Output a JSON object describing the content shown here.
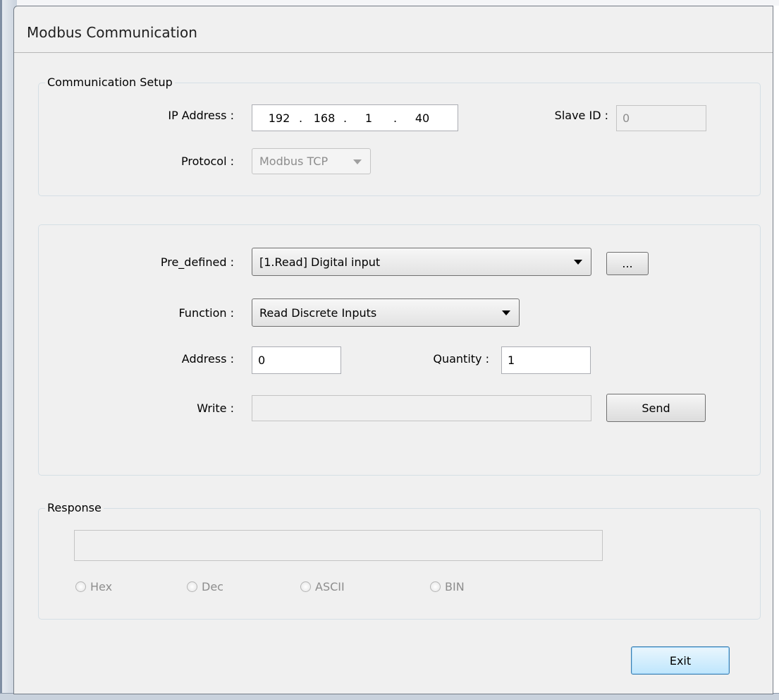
{
  "window": {
    "title": "Modbus Communication"
  },
  "setup": {
    "group_label": "Communication Setup",
    "ip_label": "IP Address :",
    "ip": {
      "o1": "192",
      "o2": "168",
      "o3": "1",
      "o4": "40"
    },
    "ip_dot": ".",
    "slave_label": "Slave ID :",
    "slave_value": "0",
    "protocol_label": "Protocol :",
    "protocol_value": "Modbus TCP"
  },
  "command": {
    "predefined_label": "Pre_defined :",
    "predefined_value": "[1.Read] Digital input",
    "browse_button": "...",
    "function_label": "Function :",
    "function_value": "Read Discrete Inputs",
    "address_label": "Address :",
    "address_value": "0",
    "quantity_label": "Quantity :",
    "quantity_value": "1",
    "write_label": "Write :",
    "write_value": "",
    "send_button": "Send"
  },
  "response": {
    "group_label": "Response",
    "value": "",
    "formats": [
      "Hex",
      "Dec",
      "ASCII",
      "BIN"
    ]
  },
  "footer": {
    "exit_button": "Exit"
  }
}
